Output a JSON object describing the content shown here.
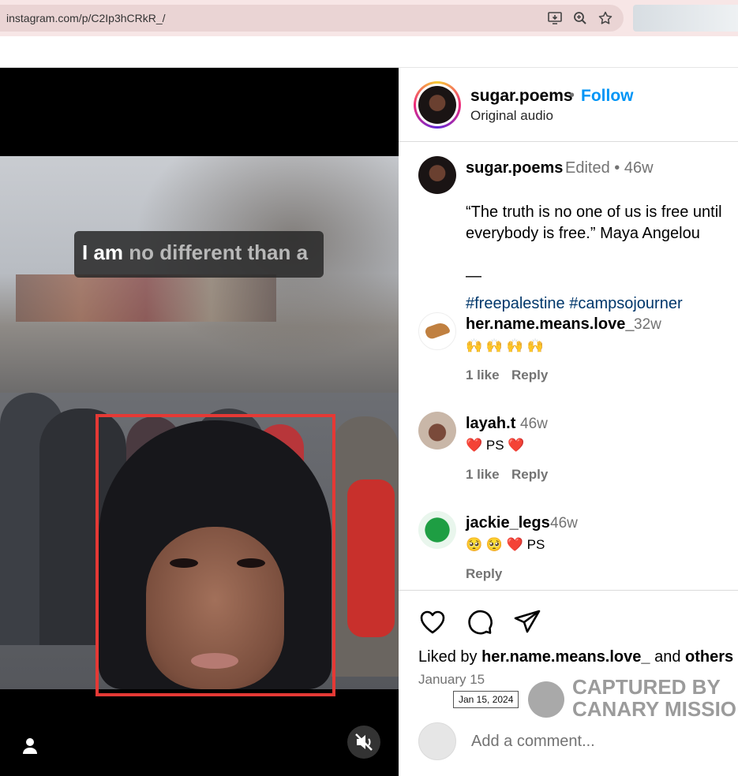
{
  "browser": {
    "url": "instagram.com/p/C2Ip3hCRkR_/",
    "icons": [
      "install-app-icon",
      "zoom-icon",
      "bookmark-star-icon"
    ]
  },
  "video": {
    "caption_bright": "I am",
    "caption_dim": "no different than a",
    "icons": [
      "user-tag-icon",
      "mute-icon"
    ],
    "highlight_color": "#e53935"
  },
  "post_header": {
    "username": "sugar.poems",
    "dot": "•",
    "follow_label": "Follow",
    "subtitle": "Original audio",
    "follow_color": "#0095f6"
  },
  "caption": {
    "username": "sugar.poems",
    "meta": "Edited  •  46w",
    "text": "“The truth is no one of us is free until everybody is free.” Maya Angelou\n\n—",
    "hashtags": "#freepalestine #campsojourner"
  },
  "comments": [
    {
      "username": "her.name.means.love_",
      "time": "32w",
      "text": "🙌 🙌 🙌 🙌",
      "likes": "1 like",
      "reply": "Reply"
    },
    {
      "username": "layah.t",
      "time": "46w",
      "text": "❤️ PS ❤️",
      "likes": "1 like",
      "reply": "Reply"
    },
    {
      "username": "jackie_legs",
      "time": "46w",
      "text": "🥺 🥺 ❤️ PS",
      "likes": "",
      "reply": "Reply"
    }
  ],
  "actions": {
    "icons": [
      "heart-icon",
      "comment-icon",
      "share-icon"
    ],
    "liked_by_prefix": "Liked by ",
    "liked_by_user": "her.name.means.love_",
    "liked_by_and": " and ",
    "liked_by_others": "others",
    "date": "January 15",
    "date_tooltip": "Jan 15, 2024"
  },
  "watermark": {
    "line1": "CAPTURED BY",
    "line2": "CANARY MISSIO"
  },
  "add_comment": {
    "placeholder": "Add a comment..."
  }
}
